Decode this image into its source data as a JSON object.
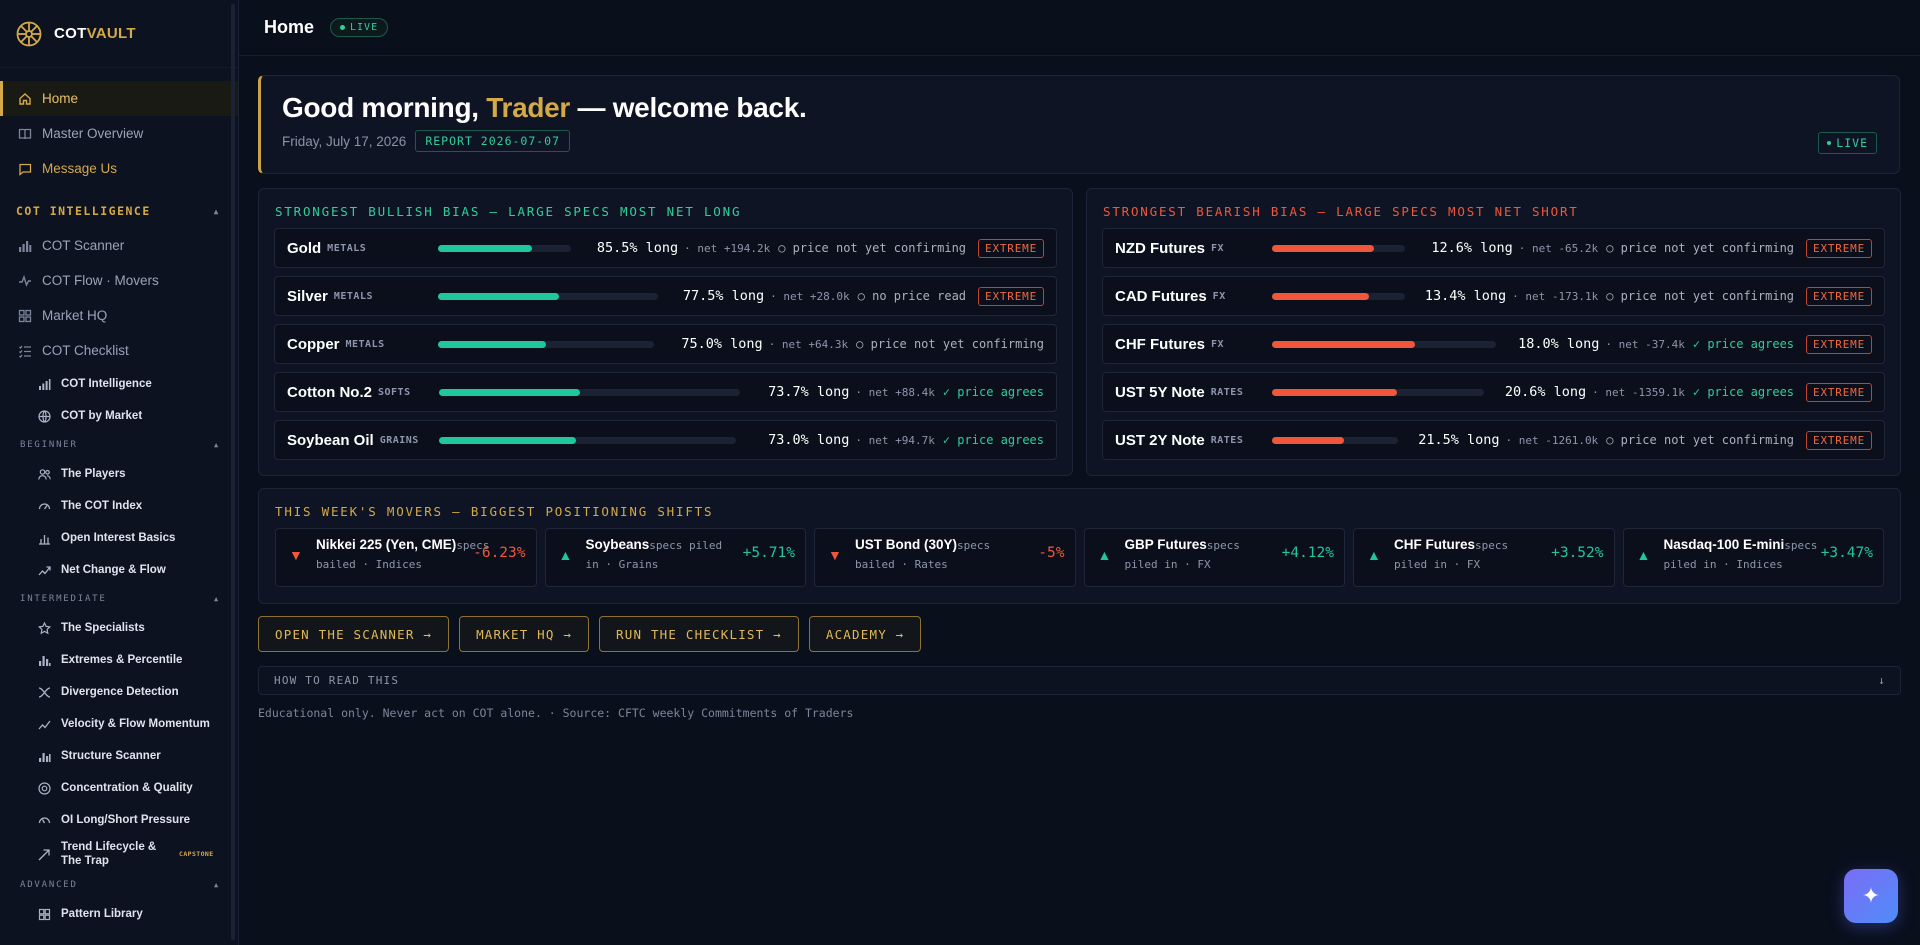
{
  "brand": {
    "name_a": "COT",
    "name_b": "VAULT"
  },
  "sidebar": {
    "top_items": [
      {
        "label": "Home",
        "icon": "home-icon"
      },
      {
        "label": "Master Overview",
        "icon": "book-icon"
      },
      {
        "label": "Message Us",
        "icon": "message-icon"
      }
    ],
    "section": "COT INTELLIGENCE",
    "intel_items": [
      {
        "label": "COT Scanner",
        "icon": "bar-chart-icon"
      },
      {
        "label": "COT Flow · Movers",
        "icon": "pulse-icon"
      },
      {
        "label": "Market HQ",
        "icon": "grid-icon"
      },
      {
        "label": "COT Checklist",
        "icon": "checklist-icon"
      }
    ],
    "sub_items": [
      {
        "label": "COT Intelligence",
        "icon": "signal-icon"
      },
      {
        "label": "COT by Market",
        "icon": "globe-icon"
      }
    ],
    "tier_beginner": "BEGINNER",
    "beginner": [
      {
        "label": "The Players",
        "icon": "users-icon"
      },
      {
        "label": "The COT Index",
        "icon": "gauge-icon"
      },
      {
        "label": "Open Interest Basics",
        "icon": "column-icon"
      },
      {
        "label": "Net Change & Flow",
        "icon": "trend-icon"
      }
    ],
    "tier_intermediate": "INTERMEDIATE",
    "intermediate": [
      {
        "label": "The Specialists",
        "icon": "star-icon"
      },
      {
        "label": "Extremes & Percentile",
        "icon": "column-icon"
      },
      {
        "label": "Divergence Detection",
        "icon": "cross-icon"
      },
      {
        "label": "Velocity & Flow Momentum",
        "icon": "trend-icon"
      },
      {
        "label": "Structure Scanner",
        "icon": "column-icon"
      },
      {
        "label": "Concentration & Quality",
        "icon": "target-icon"
      },
      {
        "label": "OI Long/Short Pressure",
        "icon": "gauge-icon"
      },
      {
        "label": "Trend Lifecycle & The Trap",
        "icon": "arrow-icon",
        "badge": "CAPSTONE"
      }
    ],
    "tier_advanced": "ADVANCED",
    "advanced": [
      {
        "label": "Pattern Library",
        "icon": "grid-icon"
      }
    ]
  },
  "header": {
    "title": "Home",
    "live": "LIVE"
  },
  "hero": {
    "greet_a": "Good morning, ",
    "greet_name": "Trader",
    "greet_b": " — welcome back.",
    "date": "Friday, July 17, 2026",
    "report": "REPORT 2026-07-07",
    "live": "LIVE"
  },
  "bullish": {
    "title": "STRONGEST BULLISH BIAS — LARGE SPECS MOST NET LONG",
    "rows": [
      {
        "name": "Gold",
        "cat": "METALS",
        "pct": "85.5% long",
        "fill": 0.71,
        "net": "· net +194.2k",
        "conf": "○ price not yet confirming",
        "ok": false,
        "tag": "EXTREME"
      },
      {
        "name": "Silver",
        "cat": "METALS",
        "pct": "77.5% long",
        "fill": 0.55,
        "net": "· net +28.0k",
        "conf": "○ no price read",
        "ok": false,
        "tag": "EXTREME"
      },
      {
        "name": "Copper",
        "cat": "METALS",
        "pct": "75.0% long",
        "fill": 0.5,
        "net": "· net +64.3k",
        "conf": "○ price not yet confirming",
        "ok": false,
        "tag": ""
      },
      {
        "name": "Cotton No.2",
        "cat": "SOFTS",
        "pct": "73.7% long",
        "fill": 0.47,
        "net": "· net +88.4k",
        "conf": "✓ price agrees",
        "ok": true,
        "tag": ""
      },
      {
        "name": "Soybean Oil",
        "cat": "GRAINS",
        "pct": "73.0% long",
        "fill": 0.46,
        "net": "· net +94.7k",
        "conf": "✓ price agrees",
        "ok": true,
        "tag": ""
      }
    ]
  },
  "bearish": {
    "title": "STRONGEST BEARISH BIAS — LARGE SPECS MOST NET SHORT",
    "rows": [
      {
        "name": "NZD Futures",
        "cat": "FX",
        "pct": "12.6% long",
        "fill": 0.77,
        "net": "· net -65.2k",
        "conf": "○ price not yet confirming",
        "ok": false,
        "tag": "EXTREME"
      },
      {
        "name": "CAD Futures",
        "cat": "FX",
        "pct": "13.4% long",
        "fill": 0.73,
        "net": "· net -173.1k",
        "conf": "○ price not yet confirming",
        "ok": false,
        "tag": "EXTREME"
      },
      {
        "name": "CHF Futures",
        "cat": "FX",
        "pct": "18.0% long",
        "fill": 0.64,
        "net": "· net -37.4k",
        "conf": "✓ price agrees",
        "ok": true,
        "tag": "EXTREME"
      },
      {
        "name": "UST 5Y Note",
        "cat": "RATES",
        "pct": "20.6% long",
        "fill": 0.59,
        "net": "· net -1359.1k",
        "conf": "✓ price agrees",
        "ok": true,
        "tag": "EXTREME"
      },
      {
        "name": "UST 2Y Note",
        "cat": "RATES",
        "pct": "21.5% long",
        "fill": 0.57,
        "net": "· net -1261.0k",
        "conf": "○ price not yet confirming",
        "ok": false,
        "tag": "EXTREME"
      }
    ]
  },
  "movers": {
    "title": "THIS WEEK'S MOVERS — BIGGEST POSITIONING SHIFTS",
    "items": [
      {
        "name": "Nikkei 225 (Yen, CME)",
        "desc1": "specs",
        "desc2": "bailed · Indices",
        "chg": "-6.23%",
        "up": false
      },
      {
        "name": "Soybeans",
        "desc1": "specs piled",
        "desc2": "in · Grains",
        "chg": "+5.71%",
        "up": true
      },
      {
        "name": "UST Bond (30Y)",
        "desc1": "specs",
        "desc2": "bailed · Rates",
        "chg": "-5%",
        "up": false
      },
      {
        "name": "GBP Futures",
        "desc1": "specs",
        "desc2": "piled in · FX",
        "chg": "+4.12%",
        "up": true
      },
      {
        "name": "CHF Futures",
        "desc1": "specs",
        "desc2": "piled in · FX",
        "chg": "+3.52%",
        "up": true
      },
      {
        "name": "Nasdaq-100 E-mini",
        "desc1": "specs",
        "desc2": "piled in · Indices",
        "chg": "+3.47%",
        "up": true
      }
    ]
  },
  "actions": [
    "OPEN THE SCANNER →",
    "MARKET HQ →",
    "RUN THE CHECKLIST →",
    "ACADEMY →"
  ],
  "howto": {
    "label": "HOW TO READ THIS",
    "arrow": "↓"
  },
  "footer": "Educational only. Never act on COT alone. · Source: CFTC weekly Commitments of Traders",
  "colors": {
    "accent": "#d4a948",
    "bull": "#1fc79a",
    "bear": "#f0573a",
    "bg": "#0a0f1c"
  }
}
